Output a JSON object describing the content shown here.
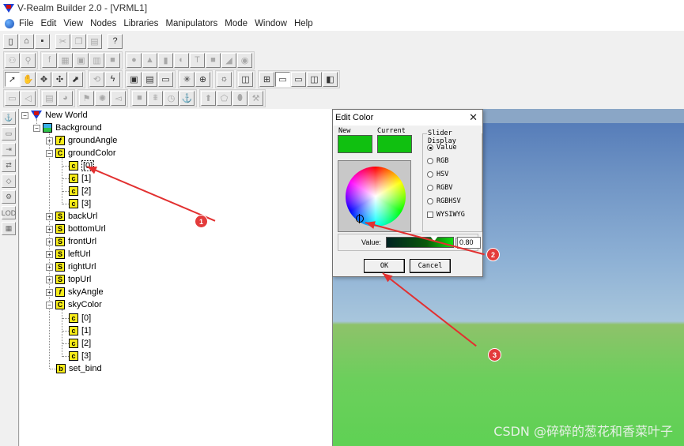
{
  "window": {
    "title": "V-Realm Builder 2.0 - [VRML1]"
  },
  "menu": [
    "File",
    "Edit",
    "View",
    "Nodes",
    "Libraries",
    "Manipulators",
    "Mode",
    "Window",
    "Help"
  ],
  "toolbar_row1": [
    "new-icon",
    "open-icon",
    "save-icon",
    "cut-icon",
    "copy-icon",
    "paste-icon",
    "help-icon"
  ],
  "tree": {
    "root": "New World",
    "background": "Background",
    "children": [
      {
        "label": "groundAngle",
        "icon": "f"
      },
      {
        "label": "groundColor",
        "icon": "C"
      },
      {
        "label": "[0]",
        "icon": "c"
      },
      {
        "label": "[1]",
        "icon": "c"
      },
      {
        "label": "[2]",
        "icon": "c"
      },
      {
        "label": "[3]",
        "icon": "c"
      },
      {
        "label": "backUrl",
        "icon": "S"
      },
      {
        "label": "bottomUrl",
        "icon": "S"
      },
      {
        "label": "frontUrl",
        "icon": "S"
      },
      {
        "label": "leftUrl",
        "icon": "S"
      },
      {
        "label": "rightUrl",
        "icon": "S"
      },
      {
        "label": "topUrl",
        "icon": "S"
      },
      {
        "label": "skyAngle",
        "icon": "f"
      },
      {
        "label": "skyColor",
        "icon": "C"
      },
      {
        "label": "[0]",
        "icon": "c"
      },
      {
        "label": "[1]",
        "icon": "c"
      },
      {
        "label": "[2]",
        "icon": "c"
      },
      {
        "label": "[3]",
        "icon": "c"
      },
      {
        "label": "set_bind",
        "icon": "b"
      }
    ]
  },
  "dialog": {
    "title": "Edit Color",
    "close": "✕",
    "new_label": "New",
    "current_label": "Current",
    "new_color": "#10c010",
    "current_color": "#10c010",
    "slider_display_label": "Slider Display",
    "radios": [
      "Value",
      "RGB",
      "HSV",
      "RGBV",
      "RGBHSV"
    ],
    "selected_radio": "Value",
    "wysiwyg_label": "WYSIWYG",
    "value_label": "Value:",
    "value": "0.80",
    "ok_label": "OK",
    "cancel_label": "Cancel"
  },
  "annotations": {
    "badge1": "1",
    "badge2": "2",
    "badge3": "3"
  },
  "watermark": "CSDN @碎碎的葱花和香菜叶子",
  "colors": {
    "accent_red": "#e23030",
    "sky": "#6e93c4",
    "ground": "#6ccf5c"
  }
}
